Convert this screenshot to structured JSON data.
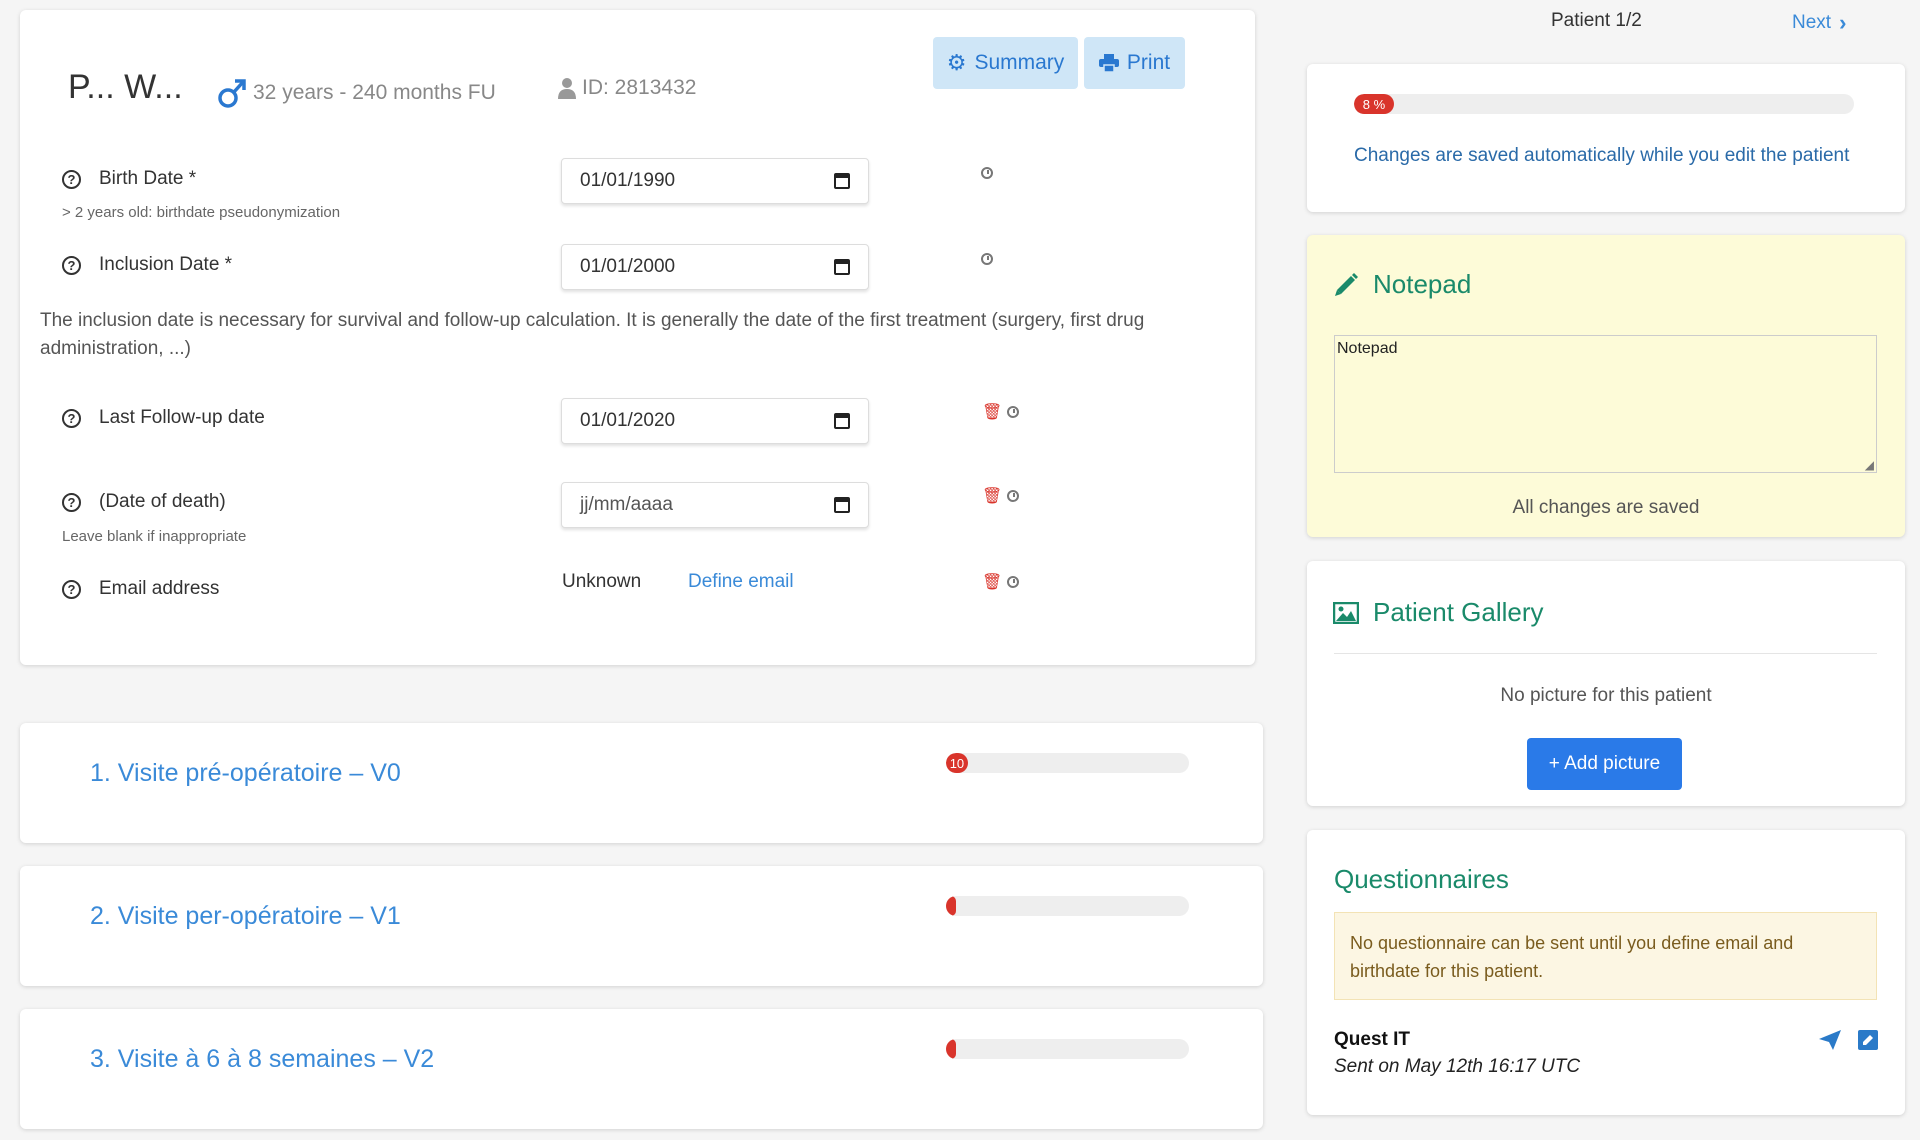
{
  "nav": {
    "patient_counter": "Patient 1/2",
    "next_label": "Next"
  },
  "patient": {
    "name": "P... W...",
    "age_followup": "32 years - 240 months FU",
    "id": "ID: 2813432",
    "summary_label": "Summary",
    "print_label": "Print"
  },
  "fields": {
    "birth_date": {
      "label": "Birth Date *",
      "hint": "> 2 years old: birthdate pseudonymization",
      "value": "01/01/1990"
    },
    "inclusion_date": {
      "label": "Inclusion Date *",
      "value": "01/01/2000"
    },
    "inclusion_note": "The inclusion date is necessary for survival and follow-up calculation. It is generally the date of the first treatment (surgery, first drug administration, ...)",
    "last_followup": {
      "label": "Last Follow-up date",
      "value": "01/01/2020"
    },
    "death_date": {
      "label": "(Date of death)",
      "hint": "Leave blank if inappropriate",
      "value": "jj/mm/aaaa"
    },
    "email": {
      "label": "Email address",
      "value": "Unknown",
      "define_label": "Define email"
    }
  },
  "visits": [
    {
      "title": "1. Visite pré-opératoire – V0",
      "progress_label": "10",
      "progress": 0.09
    },
    {
      "title": "2. Visite per-opératoire – V1",
      "progress_label": "0",
      "progress": 0
    },
    {
      "title": "3. Visite à 6 à 8 semaines – V2",
      "progress_label": "0",
      "progress": 0
    }
  ],
  "progress": {
    "label": "8 %",
    "value": 0.08,
    "message": "Changes are saved automatically while you edit the patient"
  },
  "notepad": {
    "title": "Notepad",
    "content": "Notepad",
    "status": "All changes are saved"
  },
  "gallery": {
    "title": "Patient Gallery",
    "empty": "No picture for this patient",
    "add_label": "+ Add picture"
  },
  "questionnaires": {
    "title": "Questionnaires",
    "warning": "No questionnaire can be sent until you define email and birthdate for this patient.",
    "item_name": "Quest IT",
    "item_sent": "Sent on May 12th 16:17 UTC"
  },
  "colors": {
    "accent_blue": "#3a8ad8",
    "teal": "#1a8a6a",
    "danger": "#d9342b",
    "note_bg": "#fdfbd8",
    "warn_bg": "#fcf6e3"
  }
}
